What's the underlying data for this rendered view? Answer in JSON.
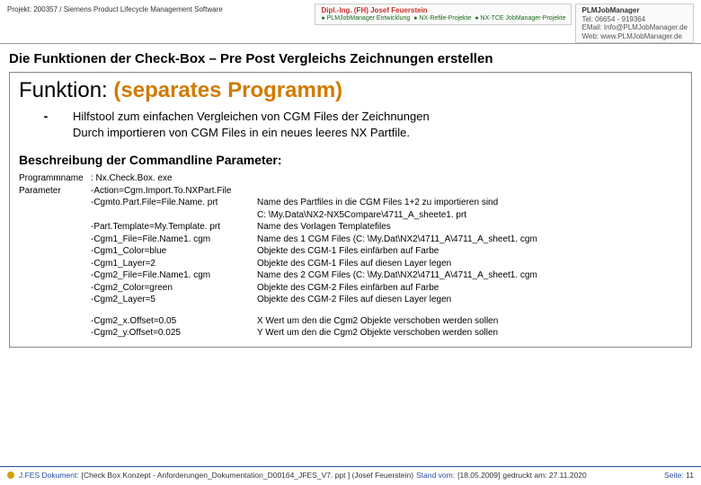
{
  "header": {
    "project": "Projekt: 200357 / Siemens Product Lifecycle Management Software",
    "logo1_title": "Dipl.-Ing. (FH) Josef Feuerstein",
    "logo1_sub_a": "● PLMJobManager Entwicklung",
    "logo1_sub_b": "● NX-Refile-Projekte",
    "logo1_sub_c": "● NX-TCE JobManager-Projekte",
    "logo2_brand": "PLMJobManager",
    "logo2_line1": "Tel: 06654 - 919364",
    "logo2_line2": "EMail: Info@PLMJobManager.de",
    "logo2_line3": "Web: www.PLMJobManager.de"
  },
  "title": "Die Funktionen der Check-Box – Pre Post Vergleichs Zeichnungen erstellen",
  "func": {
    "label": "Funktion:",
    "value": "(separates Programm)"
  },
  "desc": {
    "dash": "-",
    "line1": "Hilfstool zum einfachen Vergleichen von CGM Files der Zeichnungen",
    "line2": "Durch importieren von CGM Files in ein neues leeres NX Partfile."
  },
  "subheading": "Beschreibung der Commandline Parameter:",
  "params": {
    "progLabel": "Programmname",
    "progValue": ": Nx.Check.Box. exe",
    "paramLabel": "Parameter",
    "rows": [
      {
        "a": "-Action=Cgm.Import.To.NXPart.File",
        "b": ""
      },
      {
        "a": "-Cgmto.Part.File=File.Name. prt",
        "b": "Name des Partfiles in die CGM Files 1+2 zu importieren sind"
      },
      {
        "a": "",
        "b": "C: \\My.Data\\NX2-NX5Compare\\4711_A_sheete1. prt"
      },
      {
        "a": "-Part.Template=My.Template. prt",
        "b": "Name des Vorlagen Templatefiles"
      },
      {
        "a": "-Cgm1_File=File.Name1. cgm",
        "b": "Name des 1 CGM Files (C: \\My.Dat\\NX2\\4711_A\\4711_A_sheet1. cgm"
      },
      {
        "a": "-Cgm1_Color=blue",
        "b": "Objekte des CGM-1 Files einfärben auf Farbe"
      },
      {
        "a": "-Cgm1_Layer=2",
        "b": "Objekte des CGM-1 Files auf diesen Layer legen"
      },
      {
        "a": "-Cgm2_File=File.Name1. cgm",
        "b": "Name des 2 CGM Files (C: \\My.Dat\\NX2\\4711_A\\4711_A_sheet1. cgm"
      },
      {
        "a": "-Cgm2_Color=green",
        "b": "Objekte des CGM-2 Files einfärben auf Farbe"
      },
      {
        "a": "-Cgm2_Layer=5",
        "b": "Objekte des CGM-2 Files auf diesen Layer legen"
      }
    ],
    "rows2": [
      {
        "a": "-Cgm2_x.Offset=0.05",
        "b": "X Wert um den die Cgm2 Objekte verschoben werden sollen"
      },
      {
        "a": "-Cgm2_y.Offset=0.025",
        "b": "Y Wert um den die Cgm2 Objekte verschoben werden sollen"
      }
    ]
  },
  "footer": {
    "doclabel": "J.FES Dokument:",
    "docname": "[Check Box Konzept - Anforderungen_Dokumentation_D00164_JFES_V7. ppt ] (Josef Feuerstein)",
    "standLabel": "Stand vom:",
    "standValue": "[18.05.2009]",
    "printed": "gedruckt am: 27.11.2020",
    "pageLabel": "Seite:",
    "pageNum": "11"
  }
}
